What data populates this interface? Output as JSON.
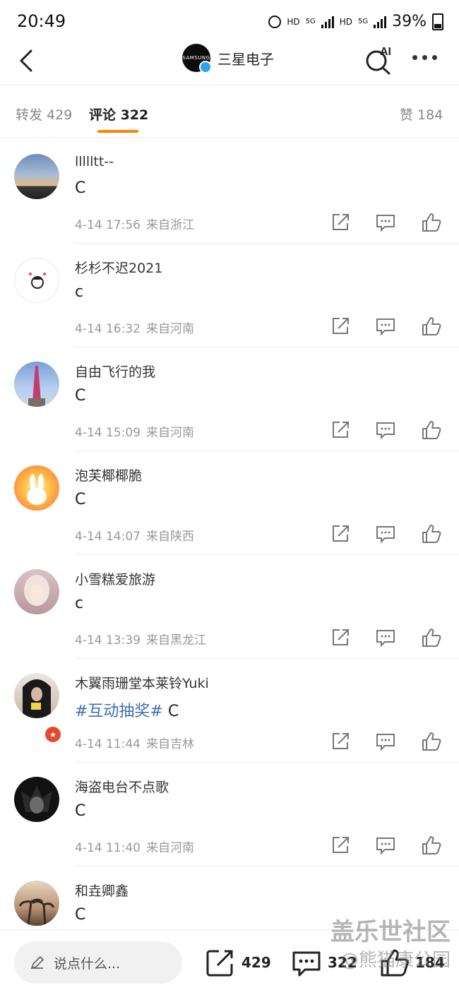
{
  "status_bar": {
    "time": "20:49",
    "network1": "HD",
    "network1_gen": "5G",
    "network2": "HD",
    "network2_gen": "5G",
    "battery": "39%"
  },
  "header": {
    "avatar_text": "SAMSUNG",
    "title": "三星电子",
    "ai_label": "AI"
  },
  "tabs": [
    {
      "label": "转发 429"
    },
    {
      "label": "评论 322"
    },
    {
      "label": "赞 184"
    }
  ],
  "comments": [
    {
      "name": "llllltt--",
      "text": "C",
      "time": "4-14 17:56",
      "location": "来自浙江"
    },
    {
      "name": "杉杉不迟2021",
      "text": "c",
      "time": "4-14 16:32",
      "location": "来自河南"
    },
    {
      "name": "自由飞行的我",
      "text": "C",
      "time": "4-14 15:09",
      "location": "来自河南"
    },
    {
      "name": "泡芙椰椰脆",
      "text": "C",
      "time": "4-14 14:07",
      "location": "来自陕西"
    },
    {
      "name": "小雪糕爱旅游",
      "text": "c",
      "time": "4-14 13:39",
      "location": "来自黑龙江"
    },
    {
      "name": "木翼雨珊堂本莱铃Yuki",
      "topic": "#互动抽奖#",
      "text": " C",
      "time": "4-14 11:44",
      "location": "来自吉林"
    },
    {
      "name": "海盗电台不点歌",
      "text": "C",
      "time": "4-14 11:40",
      "location": "来自河南"
    },
    {
      "name": "和垚卿鑫",
      "text": "C",
      "time": "",
      "location": ""
    }
  ],
  "bottom_bar": {
    "placeholder": "说点什么...",
    "repost_count": "429",
    "comment_count": "322",
    "like_count": "184"
  },
  "watermark": {
    "line1": "盖乐世社区",
    "line2": "@熊猫康公园"
  },
  "colors": {
    "accent": "#ff8200",
    "topic": "#3b6fb0",
    "verified": "#2ea4f0"
  }
}
